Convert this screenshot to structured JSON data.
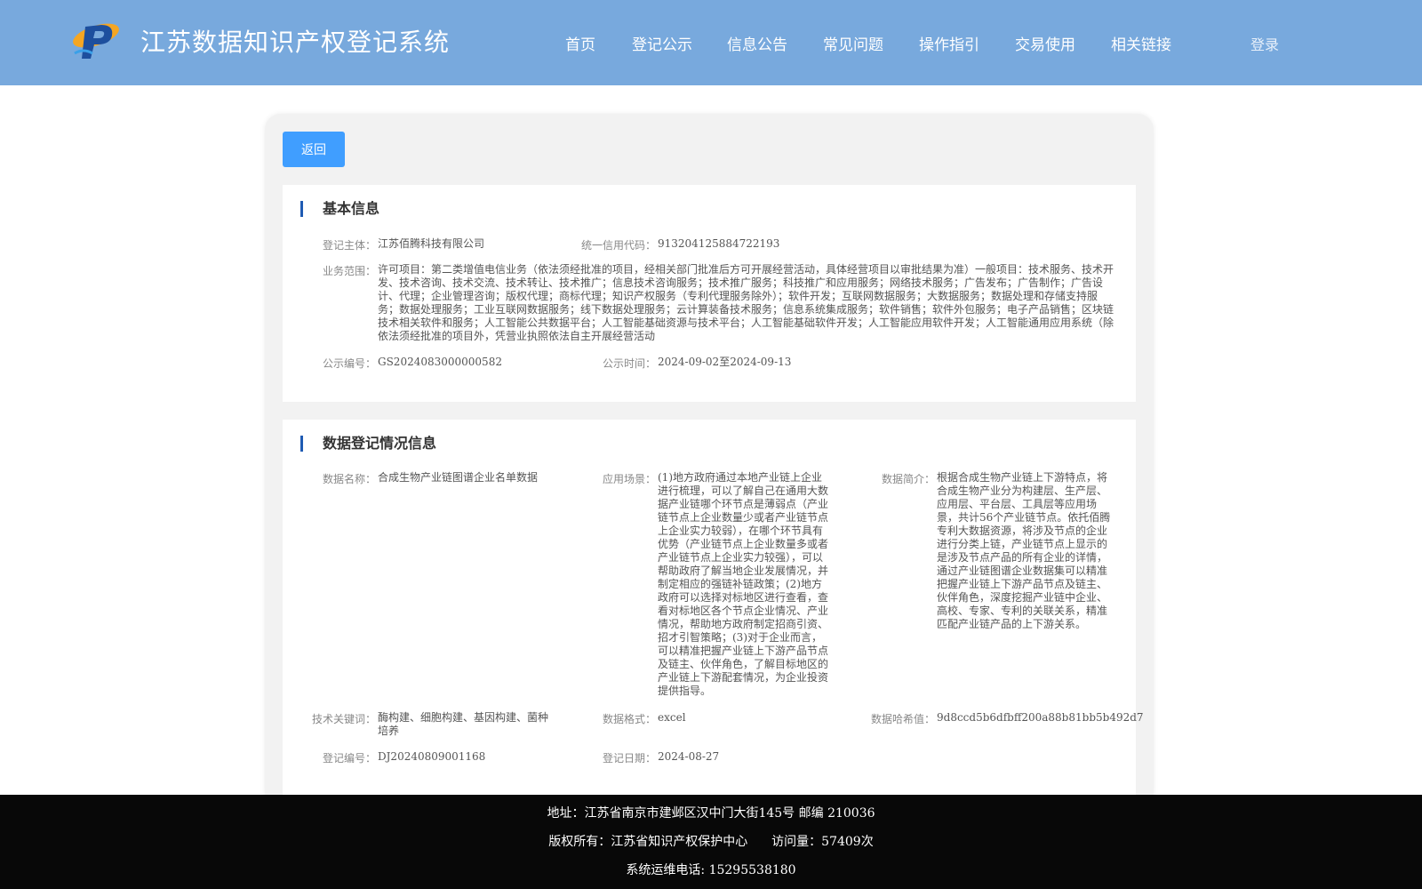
{
  "header": {
    "app_title": "江苏数据知识产权登记系统",
    "nav": [
      "首页",
      "登记公示",
      "信息公告",
      "常见问题",
      "操作指引",
      "交易使用",
      "相关链接"
    ],
    "login_label": "登录"
  },
  "actions": {
    "back_label": "返回"
  },
  "basic_info": {
    "title": "基本信息",
    "subject_label": "登记主体：",
    "subject_value": "江苏佰腾科技有限公司",
    "credit_label": "统一信用代码：",
    "credit_value": "913204125884722193",
    "scope_label": "业务范围：",
    "scope_value": "许可项目：第二类增值电信业务（依法须经批准的项目，经相关部门批准后方可开展经营活动，具体经营项目以审批结果为准）一般项目：技术服务、技术开发、技术咨询、技术交流、技术转让、技术推广；信息技术咨询服务；技术推广服务；科技推广和应用服务；网络技术服务；广告发布；广告制作；广告设计、代理；企业管理咨询；版权代理；商标代理；知识产权服务（专利代理服务除外）；软件开发；互联网数据服务；大数据服务；数据处理和存储支持服务；数据处理服务；工业互联网数据服务；线下数据处理服务；云计算装备技术服务；信息系统集成服务；软件销售；软件外包服务；电子产品销售；区块链技术相关软件和服务；人工智能公共数据平台；人工智能基础资源与技术平台；人工智能基础软件开发；人工智能应用软件开发；人工智能通用应用系统（除依法须经批准的项目外，凭营业执照依法自主开展经营活动",
    "pub_no_label": "公示编号：",
    "pub_no_value": "GS2024083000000582",
    "pub_time_label": "公示时间：",
    "pub_time_start": "2024-09-02",
    "pub_time_sep": "至",
    "pub_time_end": "2024-09-13"
  },
  "registration": {
    "title": "数据登记情况信息",
    "name_label": "数据名称：",
    "name_value": "合成生物产业链图谱企业名单数据",
    "scenario_label": "应用场景：",
    "scenario_value": "(1)地方政府通过本地产业链上企业进行梳理，可以了解自己在通用大数据产业链哪个环节点是薄弱点（产业链节点上企业数量少或者产业链节点上企业实力较弱），在哪个环节具有优势（产业链节点上企业数量多或者产业链节点上企业实力较强），可以帮助政府了解当地企业发展情况，并制定相应的强链补链政策；(2)地方政府可以选择对标地区进行查看，查看对标地区各个节点企业情况、产业情况，帮助地方政府制定招商引资、招才引智策略；(3)对于企业而言，可以精准把握产业链上下游产品节点及链主、伙伴角色，了解目标地区的产业链上下游配套情况，为企业投资提供指导。",
    "intro_label": "数据简介：",
    "intro_value": "根据合成生物产业链上下游特点，将合成生物产业分为构建层、生产层、应用层、平台层、工具层等应用场景，共计56个产业链节点。依托佰腾专利大数据资源，将涉及节点的企业进行分类上链，产业链节点上显示的是涉及节点产品的所有企业的详情，通过产业链图谱企业数据集可以精准把握产业链上下游产品节点及链主、伙伴角色，深度挖掘产业链中企业、高校、专家、专利的关联关系，精准匹配产业链产品的上下游关系。",
    "keywords_label": "技术关键词：",
    "keywords_value": "酶构建、细胞构建、基因构建、菌种培养",
    "format_label": "数据格式：",
    "format_value": "excel",
    "hash_label": "数据哈希值：",
    "hash_value": "9d8ccd5b6dfbff200a88b81bb5b492d7",
    "reg_no_label": "登记编号：",
    "reg_no_value": "DJ20240809001168",
    "reg_date_label": "登记日期：",
    "reg_date_value": "2024-08-27"
  },
  "footer": {
    "address": "地址：江苏省南京市建邺区汉中门大街145号 邮编 210036",
    "copyright": "版权所有：江苏省知识产权保护中心",
    "visits": "访问量：57409次",
    "phone": "系统运维电话: 15295538180"
  },
  "colors": {
    "header_bg": "#78a9dd",
    "button_blue": "#409eff",
    "section_marker": "#1f5bb3",
    "footer_bg": "#080808"
  }
}
